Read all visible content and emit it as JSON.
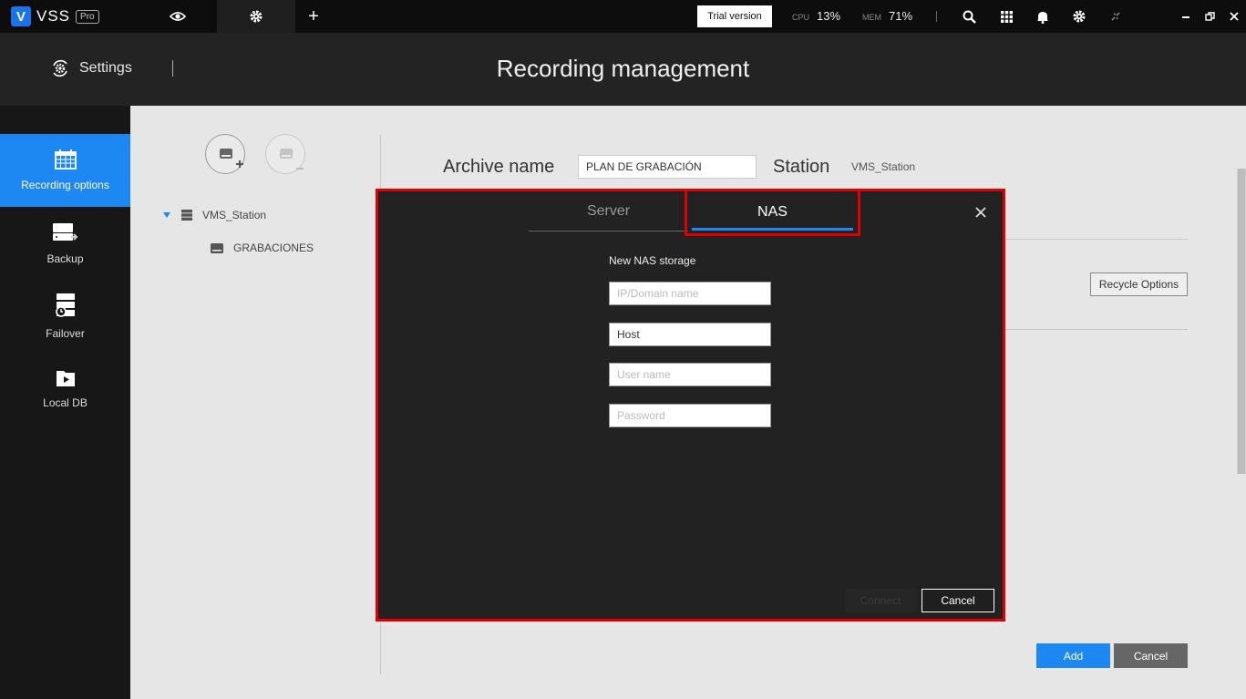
{
  "topbar": {
    "logo_text": "VSS",
    "logo_badge": "Pro",
    "tabs": [
      {
        "icon": "eye-icon"
      },
      {
        "icon": "gear-icon"
      },
      {
        "icon": "plus-icon",
        "label": "+"
      }
    ],
    "trial_label": "Trial version",
    "cpu_label": "CPU",
    "cpu_value": "13%",
    "mem_label": "MEM",
    "mem_value": "71%",
    "icons": [
      "search-icon",
      "grid-icon",
      "bell-icon",
      "gear-icon",
      "broken-link-icon",
      "minimize-icon",
      "restore-icon",
      "close-icon"
    ]
  },
  "header": {
    "section": "Settings",
    "title": "Recording management"
  },
  "sidebar": {
    "items": [
      {
        "label": "Recording options",
        "icon": "calendar-icon",
        "active": true
      },
      {
        "label": "Backup",
        "icon": "backup-icon",
        "active": false
      },
      {
        "label": "Failover",
        "icon": "failover-icon",
        "active": false
      },
      {
        "label": "Local DB",
        "icon": "folder-play-icon",
        "active": false
      }
    ]
  },
  "tree": {
    "root": "VMS_Station",
    "child": "GRABACIONES"
  },
  "form": {
    "archive_label": "Archive name",
    "archive_value": "PLAN DE GRABACIÓN",
    "station_label": "Station",
    "station_value": "VMS_Station",
    "recycle_label": "Recycle Options",
    "add_label": "Add",
    "cancel_label": "Cancel"
  },
  "dialog": {
    "tabs": [
      "Server",
      "NAS"
    ],
    "active_tab": "NAS",
    "heading": "New NAS storage",
    "fields": [
      {
        "placeholder": "IP/Domain name",
        "value": ""
      },
      {
        "placeholder": "",
        "value": "Host"
      },
      {
        "placeholder": "User name",
        "value": ""
      },
      {
        "placeholder": "Password",
        "value": ""
      }
    ],
    "connect_label": "Connect",
    "cancel_label": "Cancel"
  },
  "colors": {
    "accent": "#1e88f2",
    "highlight": "#e00000",
    "topbar": "#0d0d0d",
    "panel": "#e6e6e6"
  }
}
